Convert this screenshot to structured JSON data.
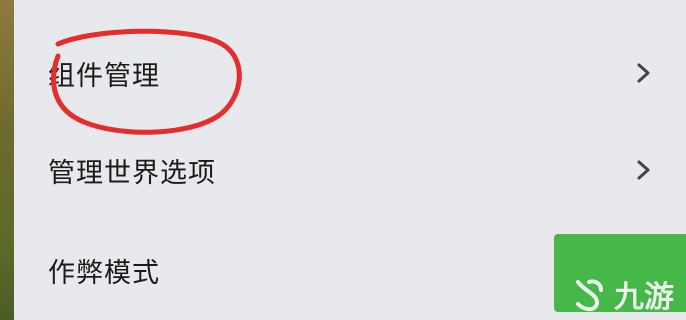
{
  "settings": {
    "items": [
      {
        "label": "组件管理",
        "has_chevron": true
      },
      {
        "label": "管理世界选项",
        "has_chevron": true
      },
      {
        "label": "作弊模式",
        "toggle_state": "on"
      }
    ]
  },
  "annotation": {
    "shape": "circle",
    "color": "#e52d2d"
  },
  "watermark": {
    "text": "九游"
  },
  "colors": {
    "background": "#e8e9ed",
    "toggle_on": "#46b84a",
    "text": "#1b1b1b",
    "chevron": "#444444"
  }
}
